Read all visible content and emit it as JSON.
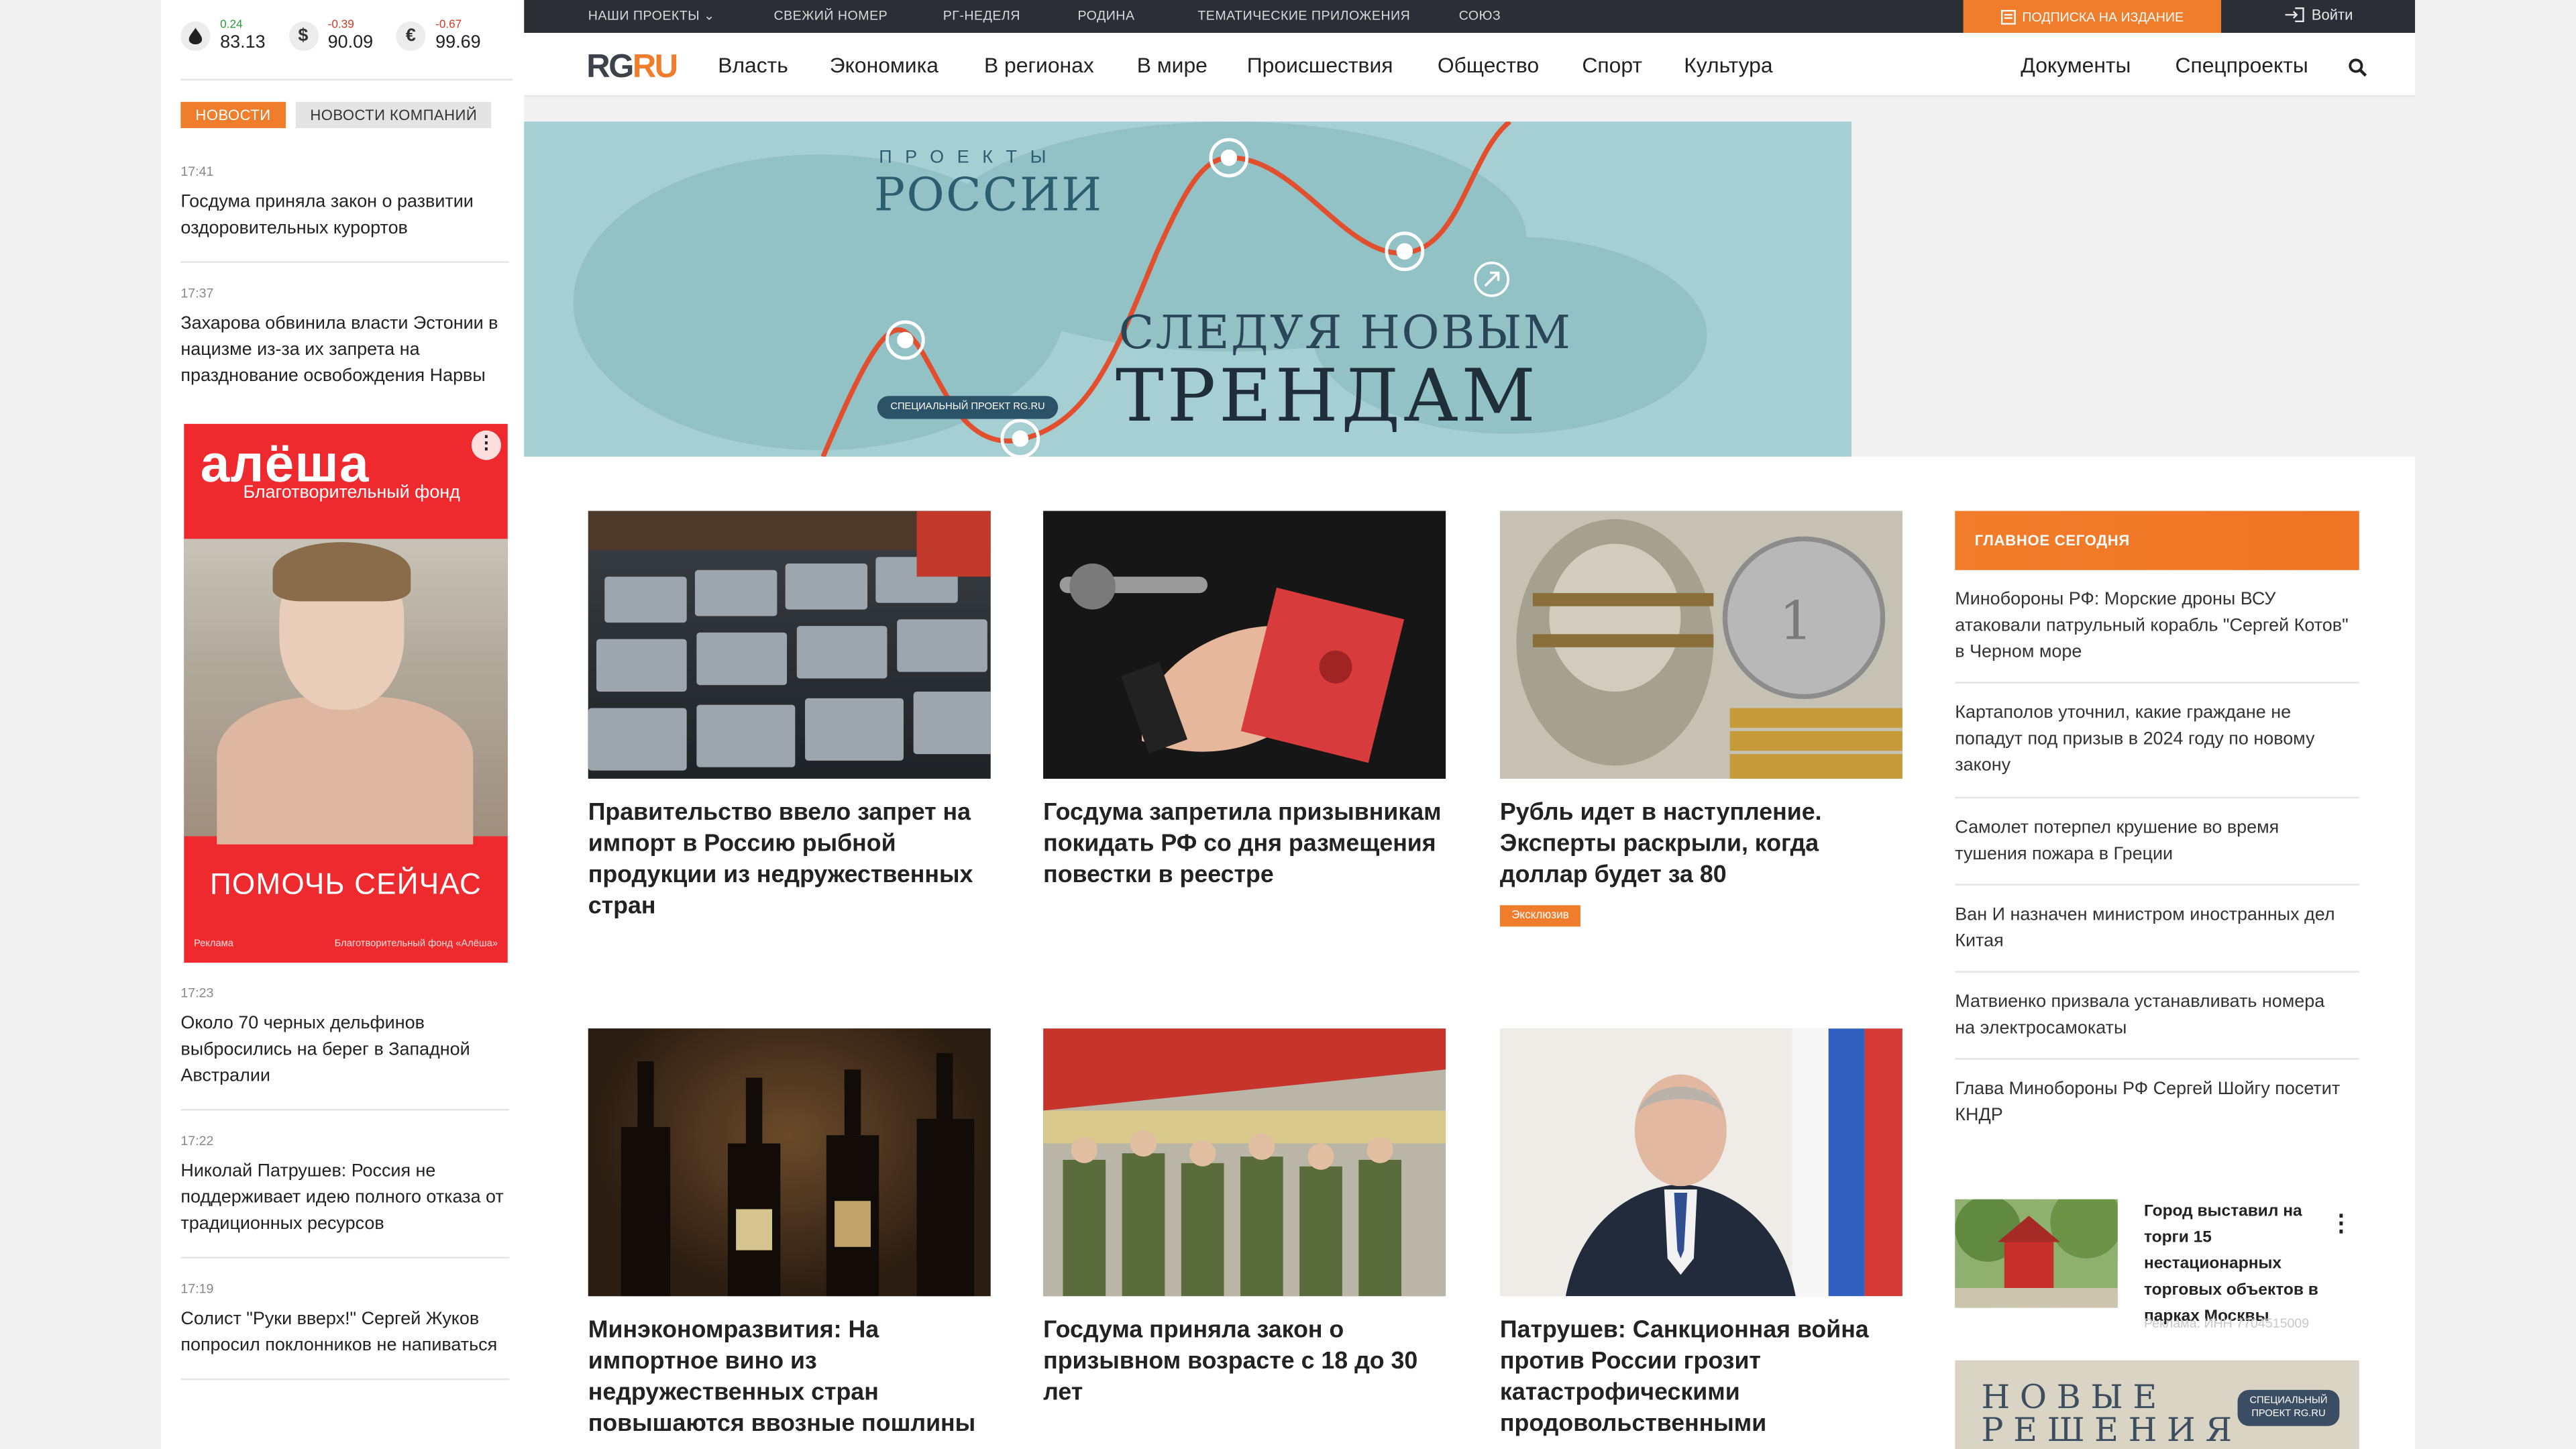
{
  "topbar": {
    "projects": "НАШИ ПРОЕКТЫ",
    "fresh_issue": "СВЕЖИЙ НОМЕР",
    "rg_week": "РГ-НЕДЕЛЯ",
    "rodina": "РОДИНА",
    "thematic": "ТЕМАТИЧЕСКИЕ ПРИЛОЖЕНИЯ",
    "soyuz": "СОЮЗ",
    "subscribe": "ПОДПИСКА НА ИЗДАНИЕ",
    "login": "Войти"
  },
  "logo": {
    "rg": "RG",
    "ru": "RU"
  },
  "nav": {
    "items": [
      "Власть",
      "Экономика",
      "В регионах",
      "В мире",
      "Происшествия",
      "Общество",
      "Спорт",
      "Культура"
    ],
    "right": [
      "Документы",
      "Спецпроекты"
    ]
  },
  "rates": [
    {
      "icon": "oil-drop-icon",
      "change": "0.24",
      "dir": "up",
      "value": "83.13"
    },
    {
      "icon": "dollar-icon",
      "change": "-0.39",
      "dir": "down",
      "value": "90.09"
    },
    {
      "icon": "euro-icon",
      "change": "-0.67",
      "dir": "down",
      "value": "99.69"
    }
  ],
  "left_tabs": {
    "news": "НОВОСТИ",
    "company_news": "НОВОСТИ КОМПАНИЙ"
  },
  "left_news": [
    {
      "time": "17:41",
      "text": "Госдума приняла закон о развитии оздоровительных курортов"
    },
    {
      "time": "17:37",
      "text": "Захарова обвинила власти Эстонии в нацизме из-за их запрета на празднование освобождения Нарвы"
    },
    {
      "time": "17:23",
      "text": "Около 70 черных дельфинов выбросились на берег в Западной Австралии"
    },
    {
      "time": "17:22",
      "text": "Николай Патрушев: Россия не поддерживает идею полного отказа от традиционных ресурсов"
    },
    {
      "time": "17:19",
      "text": "Солист \"Руки вверх!\" Сергей Жуков попросил поклонников не напиваться"
    }
  ],
  "left_ad": {
    "brand": "алёша",
    "sub": "Благотворительный фонд",
    "cta": "ПОМОЧЬ СЕЙЧАС",
    "foot_left": "Реклама",
    "foot_right": "Благотворительный фонд «Алёша»"
  },
  "banner": {
    "projects": "ПРОЕКТЫ",
    "russia": "РОССИИ",
    "line1": "СЛЕДУЯ НОВЫМ",
    "line2": "ТРЕНДАМ",
    "tag": "СПЕЦИАЛЬНЫЙ ПРОЕКТ RG.RU"
  },
  "articles": [
    {
      "title": "Правительство ввело запрет на импорт в Россию рыбной продукции из недружественных стран"
    },
    {
      "title": "Госдума запретила призывникам покидать РФ со дня размещения повестки в реестре"
    },
    {
      "title": "Рубль идет в наступление. Эксперты раскрыли, когда доллар будет за 80",
      "badge": "Эксклюзив"
    },
    {
      "title": "Минэкономразвития: На импортное вино из недружественных стран повышаются ввозные пошлины"
    },
    {
      "title": "Госдума приняла закон о призывном возрасте с 18 до 30 лет"
    },
    {
      "title": "Патрушев: Санкционная война против России грозит катастрофическими продовольственными"
    }
  ],
  "main_today": {
    "header": "ГЛАВНОЕ СЕГОДНЯ",
    "items": [
      "Минобороны РФ: Морские дроны ВСУ атаковали патрульный корабль \"Сергей Котов\" в Черном море",
      "Картаполов уточнил, какие граждане не попадут под призыв в 2024 году по новому закону",
      "Самолет потерпел крушение во время тушения пожара в Греции",
      "Ван И назначен министром иностранных дел Китая",
      "Матвиенко призвала устанавливать номера на электросамокаты",
      "Глава Минобороны РФ Сергей Шойгу посетит КНДР"
    ]
  },
  "promo": {
    "text": "Город выставил на торги 15 нестационарных торговых объектов в парках Москвы",
    "foot": "Реклама. ИНН 7704515009"
  },
  "new_solutions": {
    "title": "НОВЫЕ РЕШЕНИЯ",
    "badge": "СПЕЦИАЛЬНЫЙ ПРОЕКТ RG.RU"
  }
}
